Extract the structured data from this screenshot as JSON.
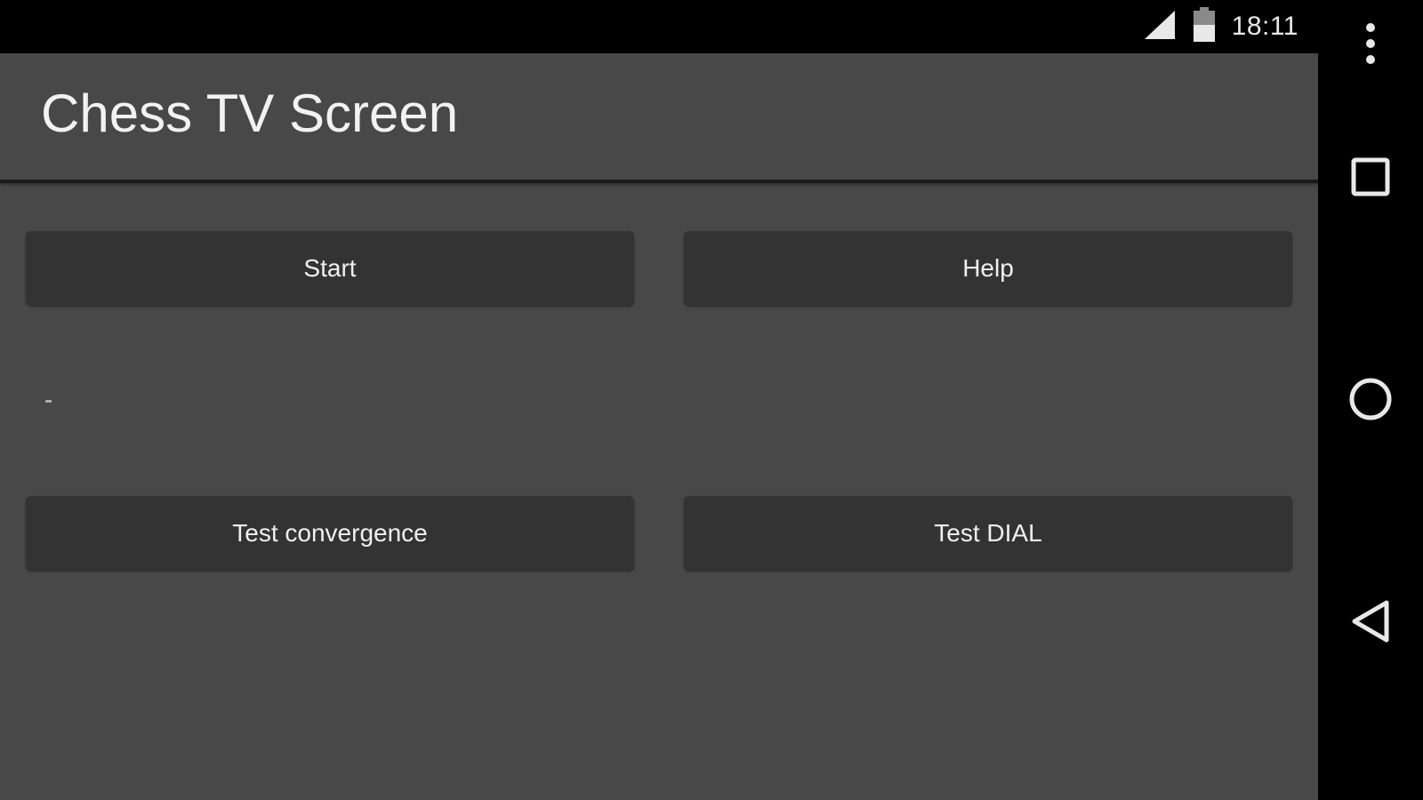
{
  "status_bar": {
    "time": "18:11",
    "signal_icon": "cell-signal-icon",
    "battery_icon": "battery-icon"
  },
  "app": {
    "title": "Chess TV Screen",
    "status_text": "-",
    "buttons": {
      "start": "Start",
      "help": "Help",
      "test_convergence": "Test convergence",
      "test_dial": "Test DIAL"
    }
  },
  "nav_bar": {
    "overflow_icon": "overflow-menu-icon",
    "recents_icon": "recents-icon",
    "home_icon": "home-icon",
    "back_icon": "back-icon"
  },
  "colors": {
    "background": "#484848",
    "button": "#333333",
    "bars": "#000000",
    "text": "#f0f0f0"
  }
}
